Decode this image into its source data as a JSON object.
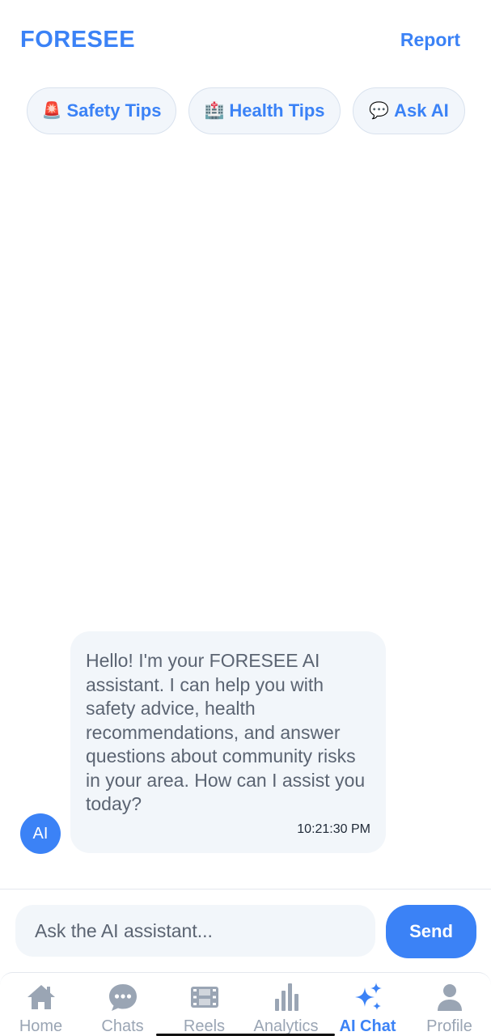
{
  "header": {
    "brand": "FORESEE",
    "report_label": "Report"
  },
  "quick_actions": [
    {
      "emoji": "🚨",
      "label": "Safety Tips"
    },
    {
      "emoji": "🏥",
      "label": "Health Tips"
    },
    {
      "emoji": "💬",
      "label": "Ask AI"
    }
  ],
  "messages": [
    {
      "sender": "AI",
      "text": "Hello! I'm your FORESEE AI assistant. I can help you with safety advice, health recommendations, and answer questions about community risks in your area. How can I assist you today?",
      "time": "10:21:30 PM"
    }
  ],
  "composer": {
    "placeholder": "Ask the AI assistant...",
    "value": "",
    "send_label": "Send"
  },
  "nav": [
    {
      "label": "Home",
      "icon": "home-icon"
    },
    {
      "label": "Chats",
      "icon": "chat-bubble-icon"
    },
    {
      "label": "Reels",
      "icon": "film-icon"
    },
    {
      "label": "Analytics",
      "icon": "bar-chart-icon"
    },
    {
      "label": "AI Chat",
      "icon": "sparkles-icon",
      "active": true
    },
    {
      "label": "Profile",
      "icon": "person-icon"
    }
  ],
  "colors": {
    "accent": "#3b82f6",
    "inactive": "#9aa5b4",
    "bubble_bg": "#f2f6fa"
  }
}
